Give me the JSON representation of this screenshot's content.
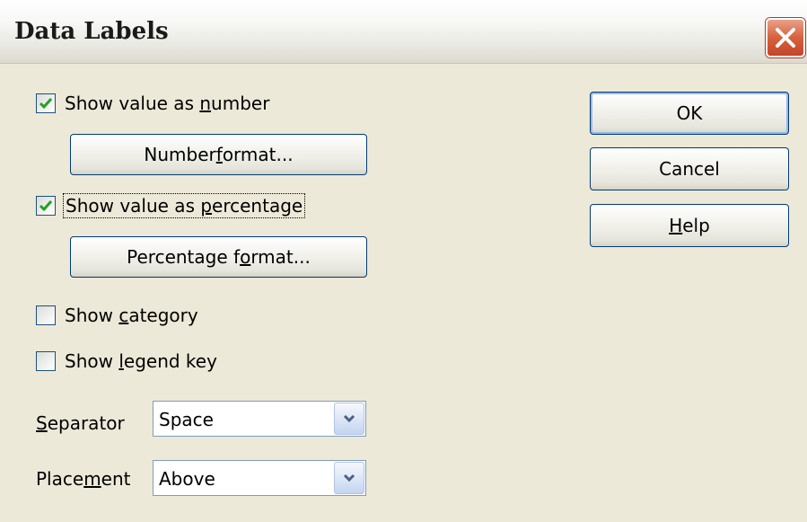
{
  "dialog": {
    "title": "Data Labels",
    "close_icon": "close-x-icon"
  },
  "options": {
    "show_value_number": {
      "label_before": "Show value as ",
      "label_mnemonic": "n",
      "label_after": "umber",
      "checked": true
    },
    "number_format_button": {
      "label_before": "Number ",
      "label_mnemonic": "f",
      "label_after": "ormat..."
    },
    "show_value_percentage": {
      "label_before": "Show value as ",
      "label_mnemonic": "p",
      "label_after": "ercentage",
      "checked": true
    },
    "percentage_format_button": {
      "label_before": "Percentage f",
      "label_mnemonic": "o",
      "label_after": "rmat..."
    },
    "show_category": {
      "label_before": "Show ",
      "label_mnemonic": "c",
      "label_after": "ategory",
      "checked": false
    },
    "show_legend_key": {
      "label_before": "Show ",
      "label_mnemonic": "l",
      "label_after": "egend key",
      "checked": false
    }
  },
  "separator": {
    "label_mnemonic": "S",
    "label_after": "eparator",
    "value": "Space"
  },
  "placement": {
    "label_before": "Place",
    "label_mnemonic": "m",
    "label_after": "ent",
    "value": "Above"
  },
  "buttons": {
    "ok": "OK",
    "cancel": "Cancel",
    "help_mnemonic": "H",
    "help_after": "elp"
  },
  "colors": {
    "dialog_bg": "#ece9d8",
    "check_mark": "#21a121",
    "button_border": "#003c74",
    "close_button": "#d8603c"
  }
}
